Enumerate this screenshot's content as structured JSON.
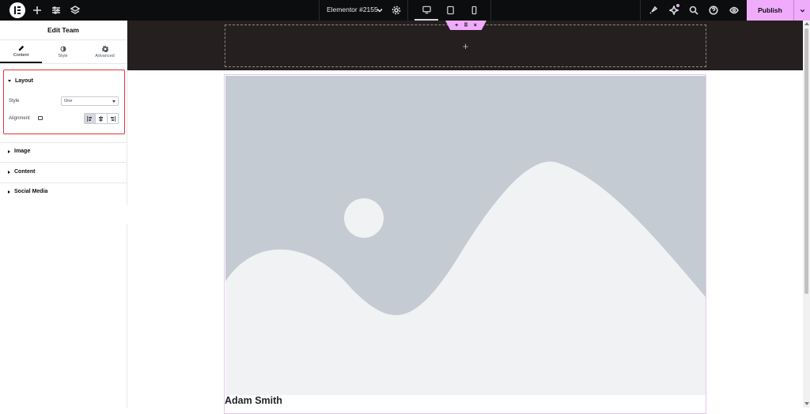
{
  "topbar": {
    "document_title": "Elementor #2155",
    "publish_label": "Publish",
    "accent_color": "#f0abfc"
  },
  "panel": {
    "title": "Edit Team",
    "tabs": [
      {
        "label": "Content",
        "icon": "pencil-icon",
        "active": true
      },
      {
        "label": "Style",
        "icon": "half-circle-icon",
        "active": false
      },
      {
        "label": "Advanced",
        "icon": "gear-icon",
        "active": false
      }
    ],
    "layout_section": {
      "title": "Layout",
      "style_label": "Style",
      "style_value": "One",
      "alignment_label": "Alignment",
      "alignment_options": [
        "left",
        "center",
        "right"
      ],
      "alignment_selected": "left"
    },
    "sections": [
      "Image",
      "Content",
      "Social Media"
    ]
  },
  "canvas": {
    "member_name": "Adam Smith",
    "drop_zone_symbol": "+"
  }
}
